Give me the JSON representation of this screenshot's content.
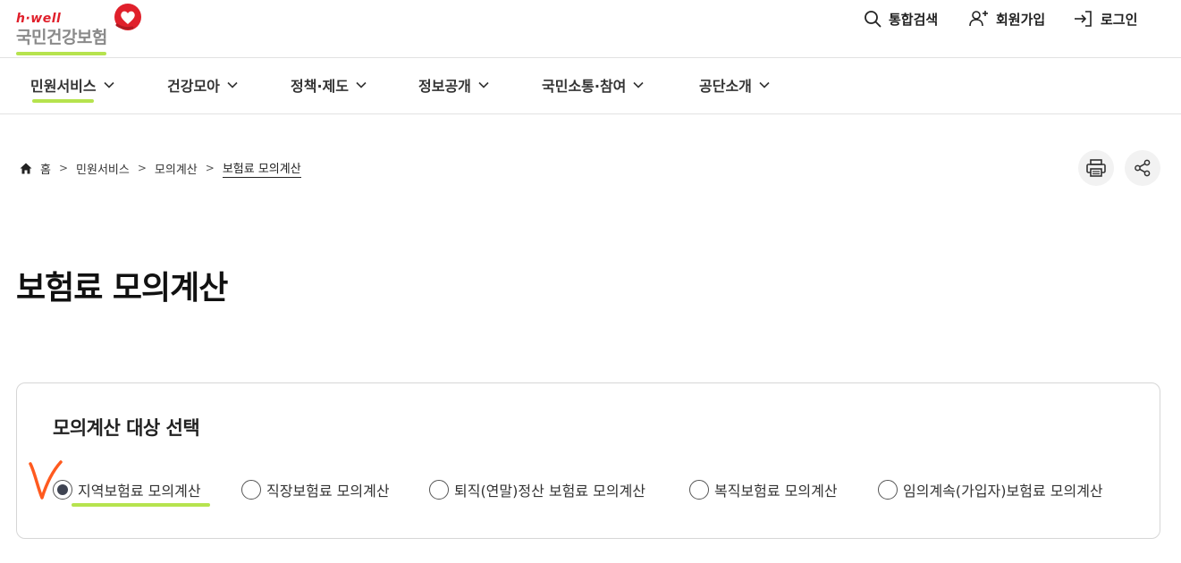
{
  "logo": {
    "sub": "h·well",
    "name": "국민건강보험"
  },
  "utility": [
    {
      "label": "통합검색",
      "icon": "search-icon"
    },
    {
      "label": "회원가입",
      "icon": "user-plus-icon"
    },
    {
      "label": "로그인",
      "icon": "login-icon"
    }
  ],
  "gnb": [
    {
      "label": "민원서비스",
      "active": true
    },
    {
      "label": "건강모아"
    },
    {
      "label": "정책·제도"
    },
    {
      "label": "정보공개"
    },
    {
      "label": "국민소통·참여"
    },
    {
      "label": "공단소개"
    }
  ],
  "breadcrumb": [
    "홈",
    "민원서비스",
    "모의계산",
    "보험료 모의계산"
  ],
  "page_title": "보험료 모의계산",
  "selection": {
    "title": "모의계산 대상 선택",
    "options": [
      {
        "label": "지역보험료 모의계산",
        "checked": true
      },
      {
        "label": "직장보험료 모의계산",
        "checked": false
      },
      {
        "label": "퇴직(연말)정산 보험료 모의계산",
        "checked": false
      },
      {
        "label": "복직보험료 모의계산",
        "checked": false
      },
      {
        "label": "임의계속(가입자)보험료 모의계산",
        "checked": false
      }
    ]
  },
  "colors": {
    "accent_green": "#b6e34e",
    "brand_red": "#e0202b",
    "annotation_orange": "#ff5a1f"
  }
}
